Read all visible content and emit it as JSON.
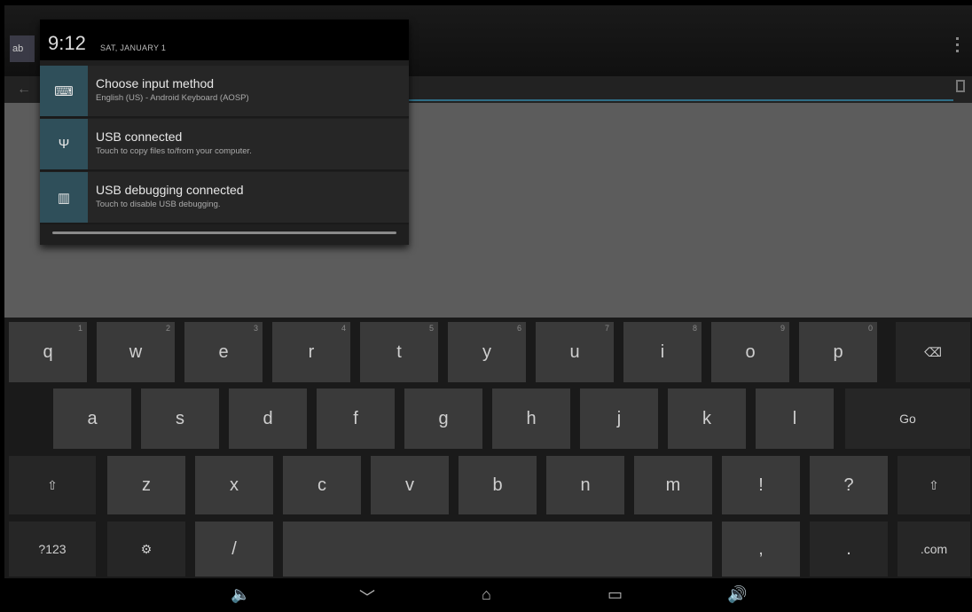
{
  "status": {
    "time": "9:12",
    "date": "SAT, JANUARY 1"
  },
  "app": {
    "icon_label": "ab"
  },
  "notifications": [
    {
      "icon": "keyboard-icon",
      "glyph": "⌨",
      "title": "Choose input method",
      "subtitle": "English (US) - Android Keyboard (AOSP)"
    },
    {
      "icon": "usb-icon",
      "glyph": "Ψ",
      "title": "USB connected",
      "subtitle": "Touch to copy files to/from your computer."
    },
    {
      "icon": "usb-debug-icon",
      "glyph": "▥",
      "title": "USB debugging connected",
      "subtitle": "Touch to disable USB debugging."
    }
  ],
  "keyboard": {
    "row1": [
      {
        "label": "q",
        "hint": "1"
      },
      {
        "label": "w",
        "hint": "2"
      },
      {
        "label": "e",
        "hint": "3"
      },
      {
        "label": "r",
        "hint": "4"
      },
      {
        "label": "t",
        "hint": "5"
      },
      {
        "label": "y",
        "hint": "6"
      },
      {
        "label": "u",
        "hint": "7"
      },
      {
        "label": "i",
        "hint": "8"
      },
      {
        "label": "o",
        "hint": "9"
      },
      {
        "label": "p",
        "hint": "0"
      },
      {
        "label": "⌫",
        "hint": ""
      }
    ],
    "row2": [
      {
        "label": "a"
      },
      {
        "label": "s"
      },
      {
        "label": "d"
      },
      {
        "label": "f"
      },
      {
        "label": "g"
      },
      {
        "label": "h"
      },
      {
        "label": "j"
      },
      {
        "label": "k"
      },
      {
        "label": "l"
      },
      {
        "label": "Go"
      }
    ],
    "row3": [
      {
        "label": "⇧"
      },
      {
        "label": "z"
      },
      {
        "label": "x"
      },
      {
        "label": "c"
      },
      {
        "label": "v"
      },
      {
        "label": "b"
      },
      {
        "label": "n"
      },
      {
        "label": "m"
      },
      {
        "label": "!"
      },
      {
        "label": "?"
      },
      {
        "label": "⇧"
      }
    ],
    "row4": [
      {
        "label": "?123"
      },
      {
        "label": "⚙"
      },
      {
        "label": "/"
      },
      {
        "label": ""
      },
      {
        "label": ","
      },
      {
        "label": "."
      },
      {
        "label": ".com"
      }
    ]
  },
  "navbar": {
    "vol_down": "🔈",
    "back": "﹀",
    "home": "⌂",
    "recents": "▭",
    "vol_up": "🔊"
  }
}
